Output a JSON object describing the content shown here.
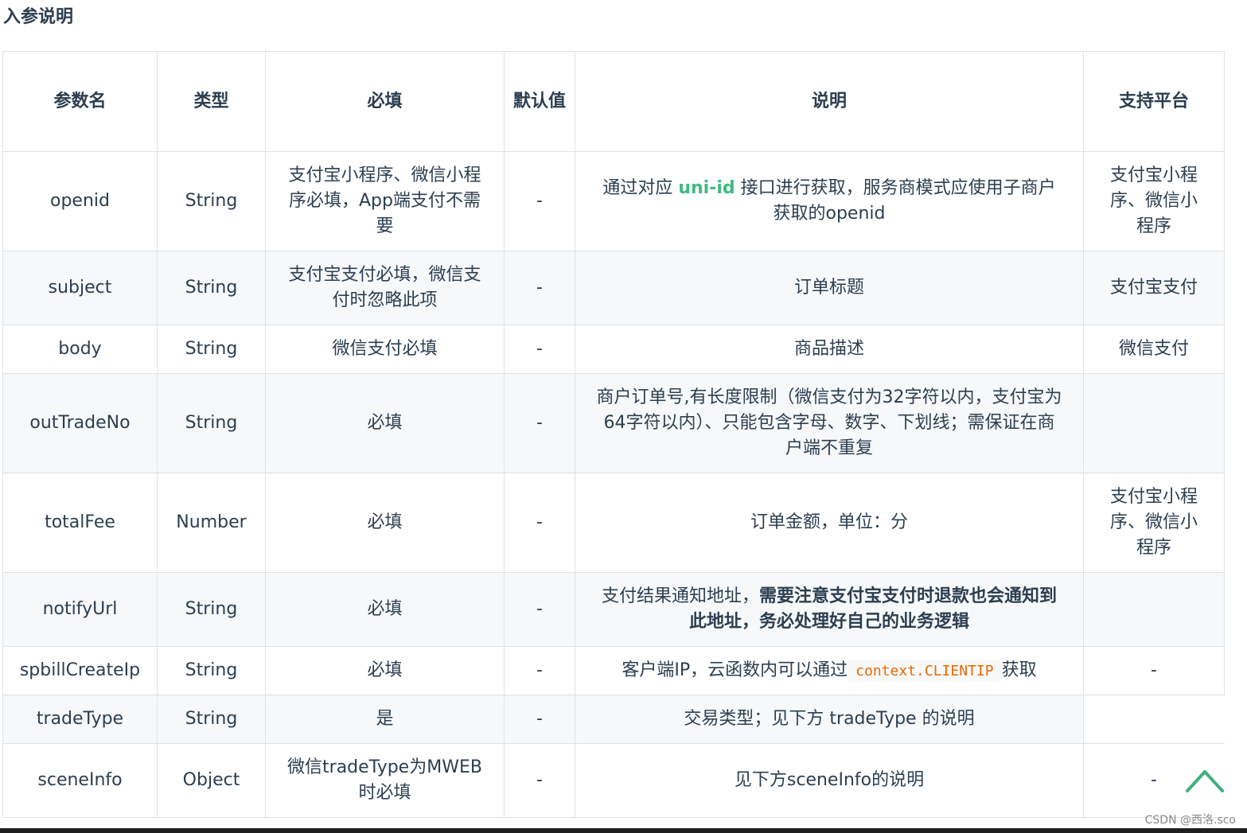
{
  "section_title": "入参说明",
  "table": {
    "headers": {
      "name": "参数名",
      "type": "类型",
      "required": "必填",
      "default": "默认值",
      "description": "说明",
      "platform": "支持平台"
    },
    "rows": [
      {
        "name": "openid",
        "type": "String",
        "required": "支付宝小程序、微信小程序必填，App端支付不需要",
        "default": "-",
        "description_prefix": "通过对应 ",
        "description_link": "uni-id",
        "description_suffix": " 接口进行获取，服务商模式应使用子商户获取的openid",
        "platform": "支付宝小程序、微信小程序"
      },
      {
        "name": "subject",
        "type": "String",
        "required": "支付宝支付必填，微信支付时忽略此项",
        "default": "-",
        "description": "订单标题",
        "platform": "支付宝支付"
      },
      {
        "name": "body",
        "type": "String",
        "required": "微信支付必填",
        "default": "-",
        "description": "商品描述",
        "platform": "微信支付"
      },
      {
        "name": "outTradeNo",
        "type": "String",
        "required": "必填",
        "default": "-",
        "description": "商户订单号,有长度限制（微信支付为32字符以内，支付宝为64字符以内）、只能包含字母、数字、下划线；需保证在商户端不重复",
        "platform": ""
      },
      {
        "name": "totalFee",
        "type": "Number",
        "required": "必填",
        "default": "-",
        "description": "订单金额，单位：分",
        "platform": "支付宝小程序、微信小程序"
      },
      {
        "name": "notifyUrl",
        "type": "String",
        "required": "必填",
        "default": "-",
        "description_prefix": "支付结果通知地址，",
        "description_strong": "需要注意支付宝支付时退款也会通知到此地址，务必处理好自己的业务逻辑",
        "platform": ""
      },
      {
        "name": "spbillCreateIp",
        "type": "String",
        "required": "必填",
        "default": "-",
        "description_prefix": "客户端IP，云函数内可以通过",
        "description_code": "context.CLIENTIP",
        "description_suffix": "获取",
        "platform": "-"
      },
      {
        "name": "tradeType",
        "type": "String",
        "required": "是",
        "default": "-",
        "description": "交易类型；见下方 tradeType 的说明",
        "platform": ""
      },
      {
        "name": "sceneInfo",
        "type": "Object",
        "required": "微信tradeType为MWEB时必填",
        "default": "-",
        "description": "见下方sceneInfo的说明",
        "platform": "-"
      }
    ]
  },
  "watermark": "CSDN @西洛.sco",
  "icons": {
    "back_to_top": "chevron-up-icon"
  },
  "colors": {
    "link": "#42b983",
    "code": "#e96900",
    "back_to_top": "#3eaf7c"
  }
}
